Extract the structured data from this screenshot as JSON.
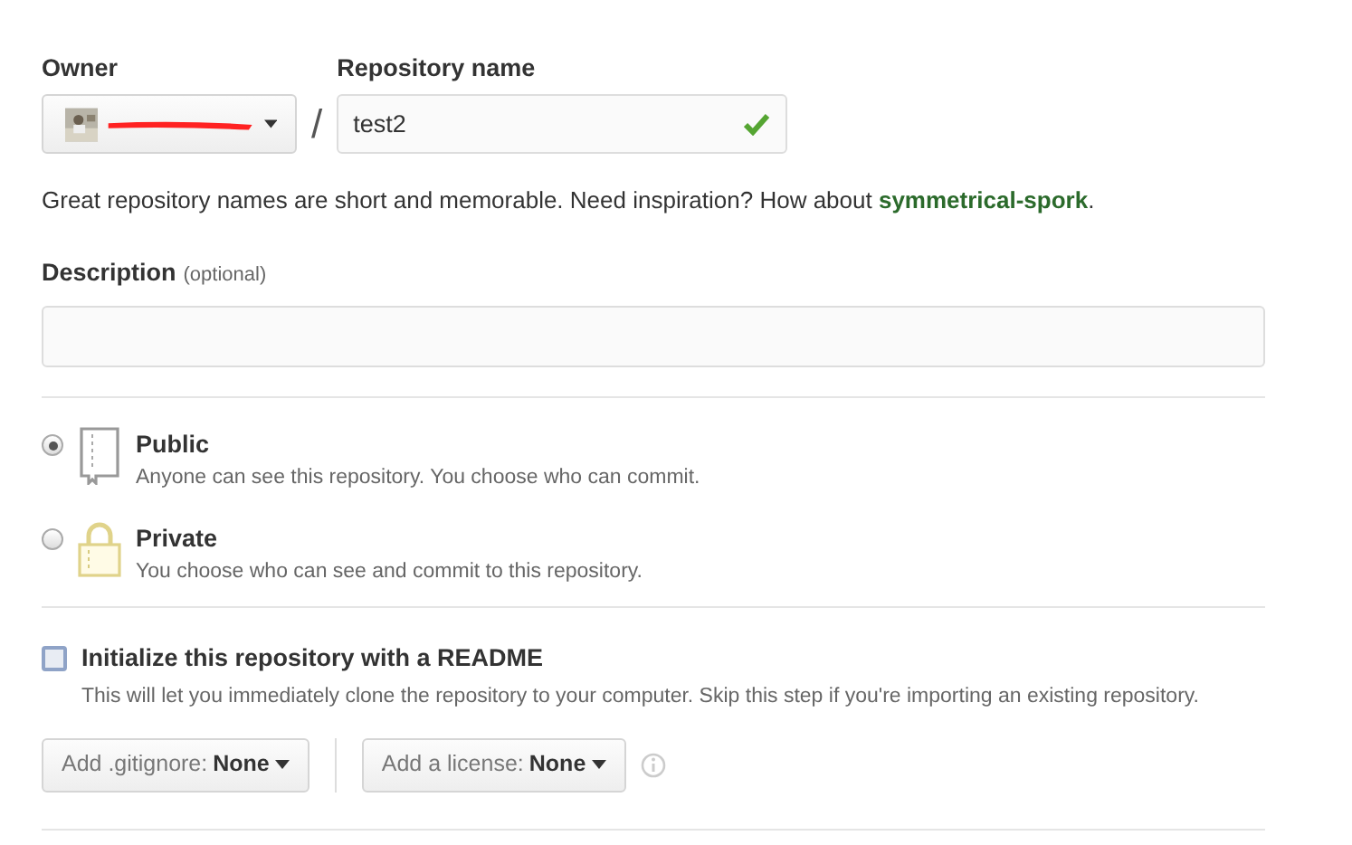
{
  "owner": {
    "label": "Owner",
    "redacted": true
  },
  "separator": "/",
  "repository": {
    "label": "Repository name",
    "value": "test2",
    "valid": true
  },
  "name_help": {
    "text": "Great repository names are short and memorable. Need inspiration? How about",
    "suggestion": "symmetrical-spork",
    "end": "."
  },
  "description": {
    "label": "Description",
    "hint": "(optional)"
  },
  "visibility": [
    {
      "kind": "public",
      "title": "Public",
      "note": "Anyone can see this repository. You choose who can commit.",
      "selected": true
    },
    {
      "kind": "private",
      "title": "Private",
      "note": "You choose who can see and commit to this repository.",
      "selected": false
    }
  ],
  "readme": {
    "label": "Initialize this repository with a README",
    "note": "This will let you immediately clone the repository to your computer. Skip this step if you're importing an existing repository.",
    "checked": false
  },
  "dropdowns": [
    {
      "label": "Add .gitignore:",
      "value": "None"
    },
    {
      "label": "Add a license:",
      "value": "None"
    }
  ]
}
